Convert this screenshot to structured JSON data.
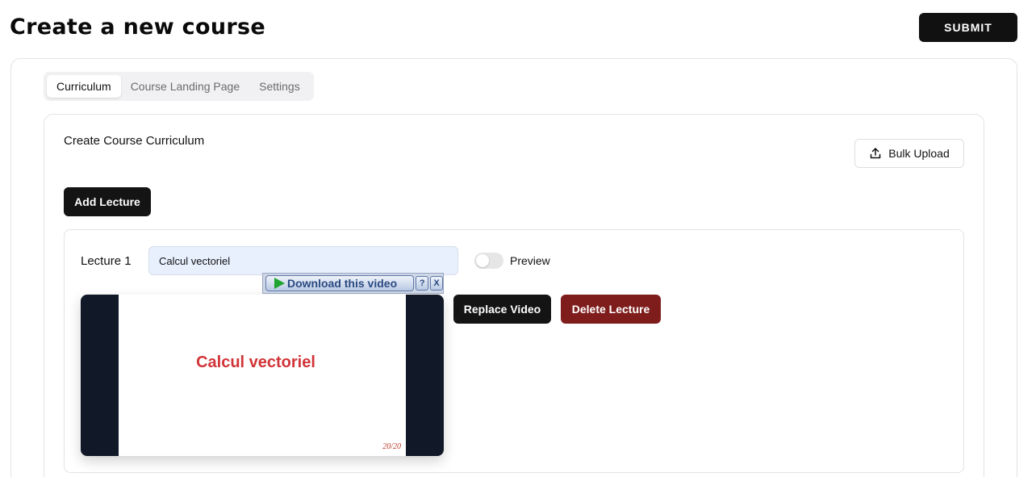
{
  "header": {
    "title": "Create a new course",
    "submit_label": "SUBMIT"
  },
  "tabs": [
    {
      "label": "Curriculum",
      "active": true
    },
    {
      "label": "Course Landing Page",
      "active": false
    },
    {
      "label": "Settings",
      "active": false
    }
  ],
  "curriculum": {
    "title": "Create Course Curriculum",
    "bulk_upload_label": "Bulk Upload",
    "bulk_upload_icon": "upload-icon",
    "add_lecture_label": "Add Lecture"
  },
  "lecture": {
    "label": "Lecture 1",
    "title_value": "Calcul vectoriel",
    "preview_label": "Preview",
    "preview_on": false,
    "replace_label": "Replace Video",
    "delete_label": "Delete Lecture"
  },
  "download_bar": {
    "label": "Download this video",
    "help": "?",
    "close": "X"
  },
  "video": {
    "slide_title": "Calcul vectoriel",
    "page_indicator": "20/20"
  },
  "colors": {
    "primary": "#141414",
    "danger": "#7f1d1d",
    "slide_title": "#d13438",
    "input_bg": "#e8f0fe"
  }
}
